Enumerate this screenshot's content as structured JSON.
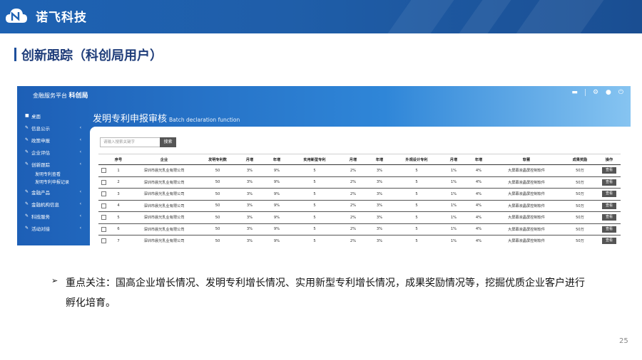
{
  "header": {
    "brand": "诺飞科技"
  },
  "section_title": "创新跟踪（科创局用户）",
  "app": {
    "title_prefix": "金融服务平台",
    "title_suffix": "科创局",
    "sidebar": [
      {
        "icon": "home-icon",
        "label": "桌面",
        "chevron": ""
      },
      {
        "icon": "pencil-icon",
        "label": "信息公示",
        "chevron": "‹"
      },
      {
        "icon": "pencil-icon",
        "label": "政策申报",
        "chevron": "‹"
      },
      {
        "icon": "pencil-icon",
        "label": "企业评估",
        "chevron": "‹"
      },
      {
        "icon": "pencil-icon",
        "label": "创新跟踪",
        "chevron": "‹"
      }
    ],
    "sidebar_sub": [
      "发明专利查看",
      "发明专利申报记录"
    ],
    "sidebar_more": [
      {
        "icon": "pencil-icon",
        "label": "金融产品",
        "chevron": "‹"
      },
      {
        "icon": "pencil-icon",
        "label": "金融机构信息",
        "chevron": "‹"
      },
      {
        "icon": "pencil-icon",
        "label": "科技服务",
        "chevron": "‹"
      },
      {
        "icon": "pencil-icon",
        "label": "活动对接",
        "chevron": "‹"
      }
    ],
    "page_title": "发明专利申报审核",
    "page_subtitle": "Batch declaration function",
    "search_placeholder": "请输入搜索关键字",
    "search_button": "搜索",
    "columns": [
      "",
      "序号",
      "企业",
      "发明专利数",
      "月增",
      "年增",
      "实用新型专利",
      "月增",
      "年增",
      "外观设计专利",
      "月增",
      "年增",
      "软著",
      "成果奖励",
      "操作"
    ],
    "rows": [
      [
        "1",
        "深圳市晨光乳业有限公司",
        "50",
        "3%",
        "9%",
        "5",
        "2%",
        "3%",
        "5",
        "1%",
        "4%",
        "大屏幕液晶屏控制软件",
        "50万",
        "查看"
      ],
      [
        "2",
        "深圳市晨光乳业有限公司",
        "50",
        "3%",
        "9%",
        "5",
        "2%",
        "3%",
        "5",
        "1%",
        "4%",
        "大屏幕液晶屏控制软件",
        "50万",
        "查看"
      ],
      [
        "3",
        "深圳市晨光乳业有限公司",
        "50",
        "3%",
        "9%",
        "5",
        "2%",
        "3%",
        "5",
        "1%",
        "4%",
        "大屏幕液晶屏控制软件",
        "50万",
        "查看"
      ],
      [
        "4",
        "深圳市晨光乳业有限公司",
        "50",
        "3%",
        "9%",
        "5",
        "2%",
        "3%",
        "5",
        "1%",
        "4%",
        "大屏幕液晶屏控制软件",
        "50万",
        "查看"
      ],
      [
        "5",
        "深圳市晨光乳业有限公司",
        "50",
        "3%",
        "9%",
        "5",
        "2%",
        "3%",
        "5",
        "1%",
        "4%",
        "大屏幕液晶屏控制软件",
        "50万",
        "查看"
      ],
      [
        "6",
        "深圳市晨光乳业有限公司",
        "50",
        "3%",
        "9%",
        "5",
        "2%",
        "3%",
        "5",
        "1%",
        "4%",
        "大屏幕液晶屏控制软件",
        "50万",
        "查看"
      ],
      [
        "7",
        "深圳市晨光乳业有限公司",
        "50",
        "3%",
        "9%",
        "5",
        "2%",
        "3%",
        "5",
        "1%",
        "4%",
        "大屏幕液晶屏控制软件",
        "50万",
        "查看"
      ]
    ]
  },
  "bullet_text": "重点关注：国高企业增长情况、发明专利增长情况、实用新型专利增长情况，成果奖励情况等，挖掘优质企业客户进行孵化培育。",
  "page_number": "25",
  "colors": {
    "banner": "#1e62b3",
    "title": "#1f3d7a",
    "button": "#555555"
  }
}
